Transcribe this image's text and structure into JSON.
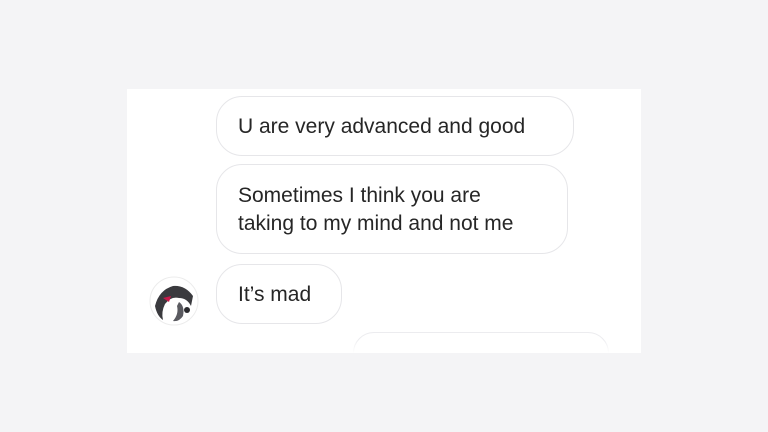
{
  "messages": [
    {
      "lines": [
        "U are very advanced and good"
      ]
    },
    {
      "lines": [
        "Sometimes I think you are",
        "taking to my mind and not me"
      ]
    },
    {
      "lines": [
        "It’s mad"
      ]
    }
  ],
  "avatar": {
    "icon": "profile-avatar"
  },
  "colors": {
    "page_bg": "#f4f4f6",
    "card_bg": "#ffffff",
    "bubble_border": "#e6e6e9",
    "text": "#262626"
  }
}
